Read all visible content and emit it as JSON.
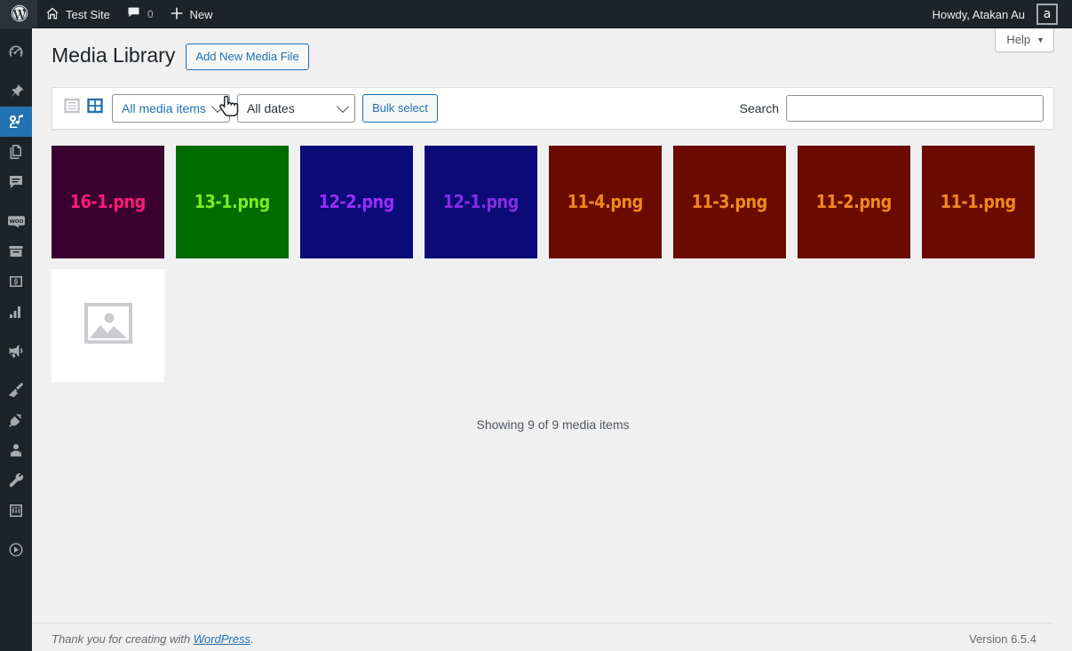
{
  "adminbar": {
    "logo_icon": "wordpress-logo-icon",
    "site_name": "Test Site",
    "site_icon": "home-icon",
    "comments_icon": "comment-bubble-icon",
    "comments_count": "0",
    "new_label": "New",
    "new_icon": "plus-icon",
    "howdy": "Howdy, Atakan Au",
    "avatar_letter": "a"
  },
  "sidebar": {
    "items": [
      {
        "name": "dashboard",
        "icon": "dashboard-gauge-icon",
        "current": false
      },
      {
        "name": "posts",
        "icon": "pin-icon",
        "current": false
      },
      {
        "name": "media",
        "icon": "media-camera-music-icon",
        "current": true
      },
      {
        "name": "pages",
        "icon": "pages-icon",
        "current": false
      },
      {
        "name": "comments",
        "icon": "comment-bubble-icon",
        "current": false
      },
      {
        "name": "woocommerce",
        "icon": "woo-bubble-icon",
        "current": false
      },
      {
        "name": "products",
        "icon": "archive-box-icon",
        "current": false
      },
      {
        "name": "payments",
        "icon": "dollar-card-icon",
        "current": false
      },
      {
        "name": "analytics",
        "icon": "bar-chart-icon",
        "current": false
      },
      {
        "name": "marketing",
        "icon": "megaphone-icon",
        "current": false
      },
      {
        "name": "appearance",
        "icon": "paintbrush-icon",
        "current": false
      },
      {
        "name": "plugins",
        "icon": "plug-icon",
        "current": false
      },
      {
        "name": "users",
        "icon": "user-icon",
        "current": false
      },
      {
        "name": "tools",
        "icon": "wrench-icon",
        "current": false
      },
      {
        "name": "settings",
        "icon": "sliders-icon",
        "current": false
      },
      {
        "name": "collapse-menu",
        "icon": "collapse-arrow-icon",
        "current": false
      }
    ]
  },
  "screen_meta": {
    "help_label": "Help",
    "help_caret": "▼"
  },
  "header": {
    "title": "Media Library",
    "add_new_label": "Add New Media File"
  },
  "toolbar": {
    "list_view_icon": "list-view-icon",
    "grid_view_icon": "grid-view-icon",
    "media_filter_value": "All media items",
    "date_filter_value": "All dates",
    "bulk_select_label": "Bulk select",
    "search_label": "Search",
    "search_value": "",
    "search_placeholder": ""
  },
  "media": {
    "items": [
      {
        "filename": "16-1.png",
        "bg": "#3a0030",
        "fg": "#ff1a7a",
        "placeholder": false
      },
      {
        "filename": "13-1.png",
        "bg": "#006b00",
        "fg": "#7bec22",
        "placeholder": false
      },
      {
        "filename": "12-2.png",
        "bg": "#0a0a78",
        "fg": "#9b2bff",
        "placeholder": false
      },
      {
        "filename": "12-1.png",
        "bg": "#0a0a78",
        "fg": "#8a2be2",
        "placeholder": false
      },
      {
        "filename": "11-4.png",
        "bg": "#6b0b00",
        "fg": "#f08a1e",
        "placeholder": false
      },
      {
        "filename": "11-3.png",
        "bg": "#6b0b00",
        "fg": "#f08a1e",
        "placeholder": false
      },
      {
        "filename": "11-2.png",
        "bg": "#6b0b00",
        "fg": "#f08a1e",
        "placeholder": false
      },
      {
        "filename": "11-1.png",
        "bg": "#6b0b00",
        "fg": "#f08a1e",
        "placeholder": false
      },
      {
        "filename": "",
        "bg": "#ffffff",
        "fg": "#c3c4c7",
        "placeholder": true
      }
    ],
    "showing_text": "Showing 9 of 9 media items"
  },
  "footer": {
    "thanks_prefix": "Thank you for creating with ",
    "wordpress_link": "WordPress",
    "thanks_suffix": ".",
    "version": "Version 6.5.4"
  },
  "cursor": {
    "type": "pointer-hand-cursor"
  },
  "colors": {
    "admin_dark": "#1d2327",
    "accent_blue": "#2271b1",
    "page_bg": "#f0f0f1"
  }
}
